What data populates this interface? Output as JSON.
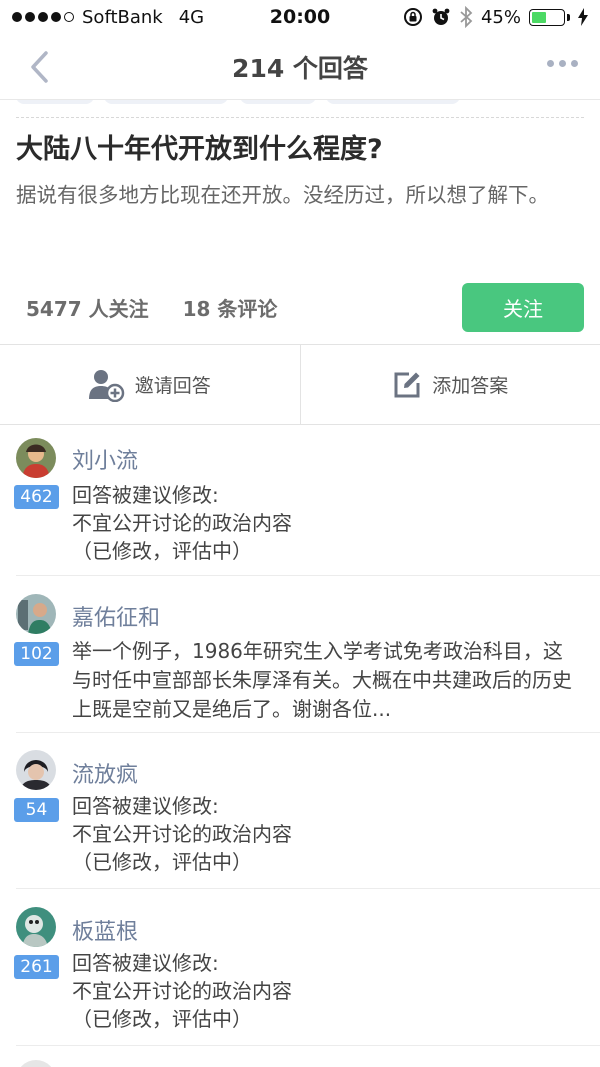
{
  "status_bar": {
    "carrier": "SoftBank",
    "network": "4G",
    "time": "20:00",
    "battery_text": "45%",
    "battery_level": 0.45,
    "icons": [
      "rotation-lock-icon",
      "alarm-icon",
      "bluetooth-icon",
      "charging-bolt-icon"
    ]
  },
  "nav": {
    "title": "214 个回答",
    "back_icon": "chevron-left-icon",
    "more_icon": "more-dots-icon"
  },
  "question": {
    "title": "大陆八十年代开放到什么程度?",
    "description": "据说有很多地方比现在还开放。没经历过，所以想了解下。",
    "followers": "5477 人关注",
    "comments": "18 条评论",
    "follow_label": "关注"
  },
  "actions": {
    "invite_label": "邀请回答",
    "add_answer_label": "添加答案"
  },
  "colors": {
    "accent_green": "#49c77f",
    "vote_blue": "#5b9ee9",
    "author_name": "#6f7f9b"
  },
  "answers": [
    {
      "author": "刘小流",
      "votes": "462",
      "lines": [
        "回答被建议修改:",
        "不宜公开讨论的政治内容",
        "（已修改，评估中）"
      ]
    },
    {
      "author": "嘉佑征和",
      "votes": "102",
      "excerpt": "举一个例子，1986年研究生入学考试免考政治科目，这与时任中宣部部长朱厚泽有关。大概在中共建政后的历史上既是空前又是绝后了。谢谢各位..."
    },
    {
      "author": "流放疯",
      "votes": "54",
      "lines": [
        "回答被建议修改:",
        "不宜公开讨论的政治内容",
        "（已修改，评估中）"
      ]
    },
    {
      "author": "板蓝根",
      "votes": "261",
      "lines": [
        "回答被建议修改:",
        "不宜公开讨论的政治内容",
        "（已修改，评估中）"
      ]
    }
  ]
}
